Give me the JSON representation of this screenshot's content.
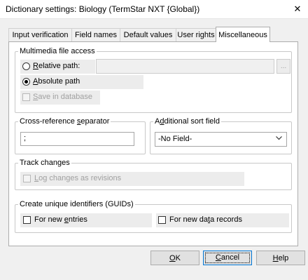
{
  "window": {
    "title": "Dictionary settings: Biology (TermStar NXT {Global})",
    "close_glyph": "✕"
  },
  "tabs": [
    {
      "label": "Input verification",
      "active": false
    },
    {
      "label": "Field names",
      "active": false
    },
    {
      "label": "Default values",
      "active": false
    },
    {
      "label": "User rights",
      "active": false
    },
    {
      "label": "Miscellaneous",
      "active": true
    }
  ],
  "multimedia": {
    "legend": "Multimedia file access",
    "relative_pre": "",
    "relative_key": "R",
    "relative_post": "elative path:",
    "relative_checked": false,
    "relative_value": "",
    "browse_label": "...",
    "absolute_pre": "",
    "absolute_key": "A",
    "absolute_post": "bsolute path",
    "absolute_checked": true,
    "save_pre": "",
    "save_key": "S",
    "save_post": "ave in database",
    "save_checked": false
  },
  "crossref": {
    "legend_pre": "Cross-reference ",
    "legend_key": "s",
    "legend_post": "eparator",
    "value": ";"
  },
  "sortfield": {
    "legend_pre": "A",
    "legend_key": "d",
    "legend_post": "ditional sort field",
    "selected": "-No Field-"
  },
  "track": {
    "legend": "Track changes",
    "log_pre": "",
    "log_key": "L",
    "log_post": "og changes as revisions",
    "log_checked": false
  },
  "guids": {
    "legend": "Create unique identifiers (GUIDs)",
    "entries_pre": "For new ",
    "entries_key": "e",
    "entries_post": "ntries",
    "entries_checked": false,
    "records_pre": "For new da",
    "records_key": "t",
    "records_post": "a records",
    "records_checked": false
  },
  "buttons": {
    "ok_pre": "",
    "ok_key": "O",
    "ok_post": "K",
    "cancel_pre": "",
    "cancel_key": "C",
    "cancel_post": "ancel",
    "help_pre": "",
    "help_key": "H",
    "help_post": "elp"
  },
  "colors": {
    "accent": "#0078d7",
    "disabled_text": "#a0a0a0",
    "group_shade": "#ececec"
  }
}
